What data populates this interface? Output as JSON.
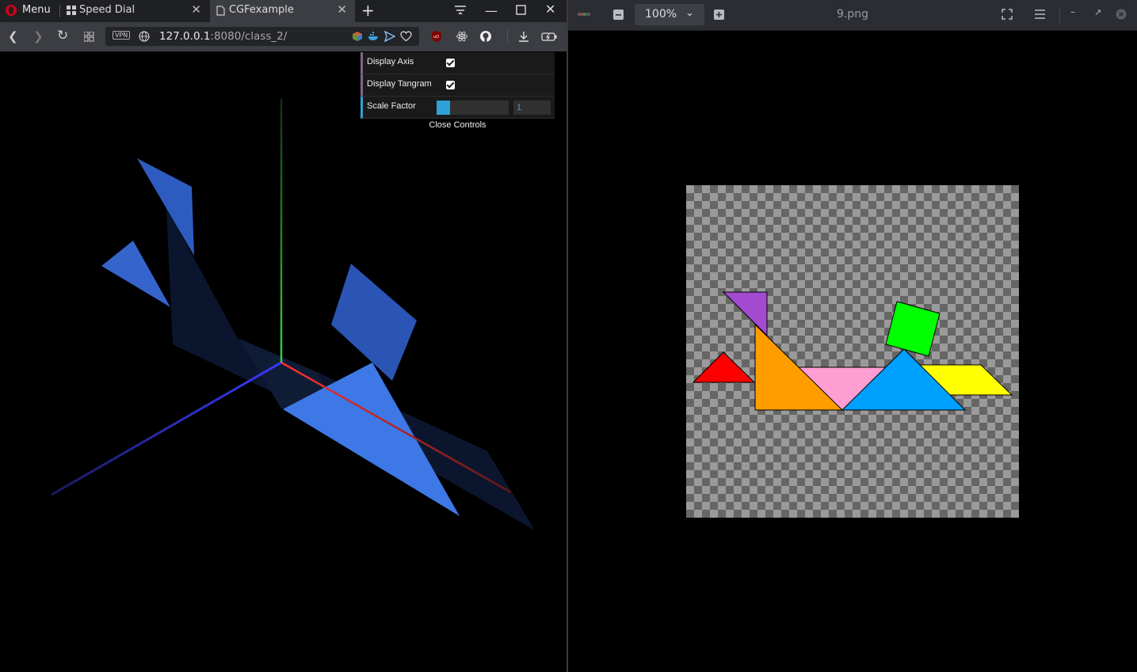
{
  "browser": {
    "menu_label": "Menu",
    "tabs": [
      {
        "label": "Speed Dial",
        "active": false
      },
      {
        "label": "CGFexample",
        "active": true
      }
    ],
    "url_host": "127.0.0.1",
    "url_rest": ":8080/class_2/",
    "vpn_label": "VPN"
  },
  "gui": {
    "display_axis_label": "Display Axis",
    "display_axis_checked": true,
    "display_tangram_label": "Display Tangram",
    "display_tangram_checked": true,
    "scale_factor_label": "Scale Factor",
    "scale_factor_value": "1",
    "close_label": "Close Controls"
  },
  "viewer": {
    "zoom": "100%",
    "title": "9.png"
  },
  "colors": {
    "red": "#ff0000",
    "purple": "#a24ad0",
    "orange": "#ff9c00",
    "pink": "#ff9ed2",
    "blue": "#00a0ff",
    "yellow": "#ffff00",
    "green": "#00ff00"
  }
}
